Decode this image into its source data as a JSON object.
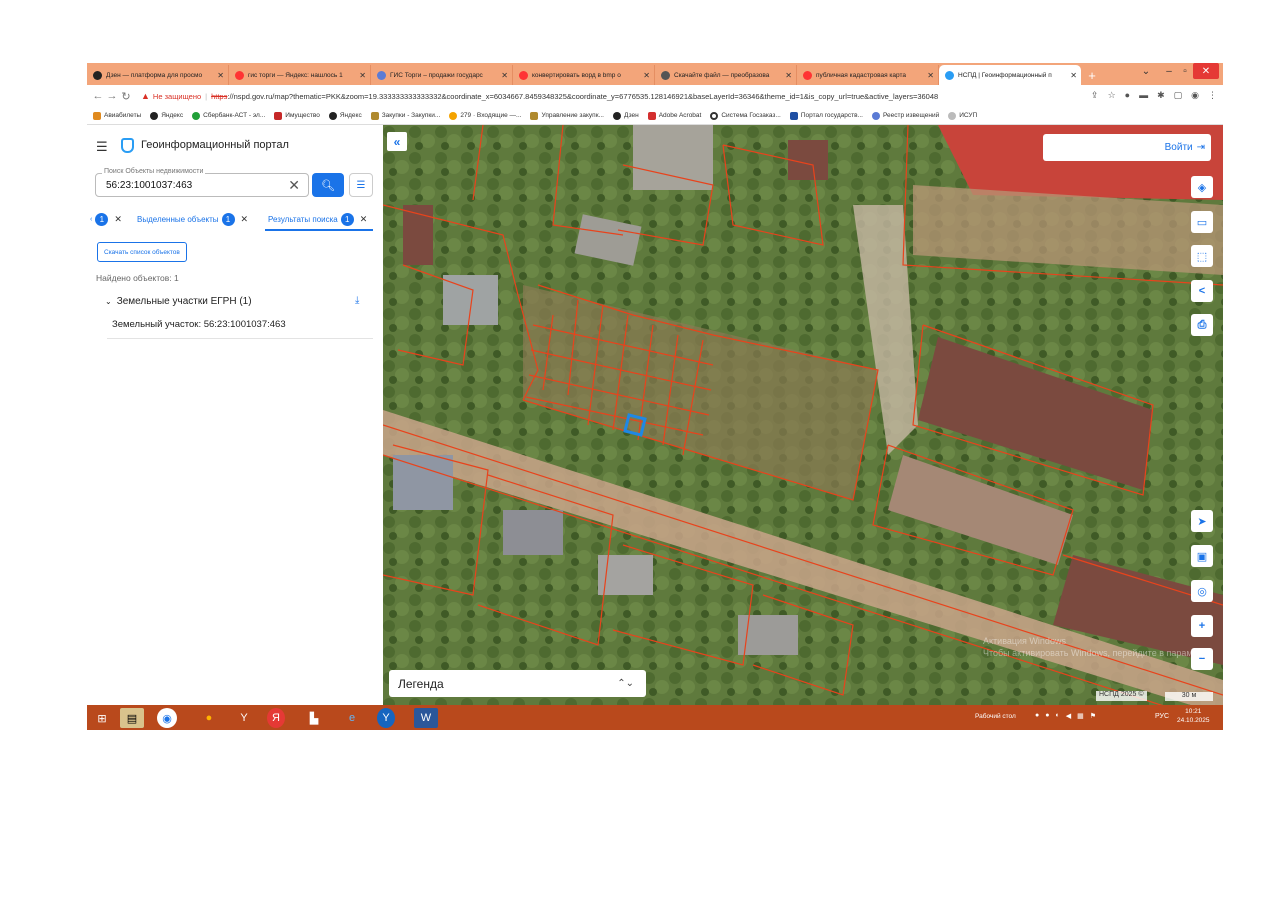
{
  "browser": {
    "tabs": [
      {
        "title": "Дзен — платформа для просмо",
        "icon": "dzen-icon",
        "color": "#222222",
        "active": false
      },
      {
        "title": "гис торги — Яндекс: нашлось 1",
        "icon": "yandex-icon",
        "color": "#f33",
        "active": false
      },
      {
        "title": "ГИС Торги – продажи государс",
        "icon": "gis-torgi-icon",
        "color": "#5b7bd5",
        "active": false
      },
      {
        "title": "конвертировать ворд в bmp о",
        "icon": "yandex-icon",
        "color": "#f33",
        "active": false
      },
      {
        "title": "Скачайте файл — преобразова",
        "icon": "converter-icon",
        "color": "#555555",
        "active": false
      },
      {
        "title": "публичная кадастровая карта",
        "icon": "yandex-icon",
        "color": "#f33",
        "active": false
      },
      {
        "title": "НСПД | Геоинформационный п",
        "icon": "nspd-icon",
        "color": "#2a9df4",
        "active": true
      }
    ],
    "not_secure_label": "Не защищено",
    "url_scheme": "https",
    "url_rest": "://nspd.gov.ru/map?thematic=PKK&zoom=19.333333333333332&coordinate_x=6034667.8459348325&coordinate_y=6776535.128146921&baseLayerId=36346&theme_id=1&is_copy_url=true&active_layers=36048",
    "bookmarks": [
      {
        "label": "Авиабилеты",
        "color": "#e08a1e"
      },
      {
        "label": "Яндекс",
        "color": "#222222"
      },
      {
        "label": "Сбербанк-АСТ - эл...",
        "color": "#21a038"
      },
      {
        "label": "Имущество",
        "color": "#c62828"
      },
      {
        "label": "Яндекс",
        "color": "#222222"
      },
      {
        "label": "Закупки - Закупки...",
        "color": "#b08a2e"
      },
      {
        "label": "279 · Входящие —...",
        "color": "#f4a300"
      },
      {
        "label": "Управление закупк...",
        "color": "#b08a2e"
      },
      {
        "label": "Дзен",
        "color": "#222222"
      },
      {
        "label": "Adobe Acrobat",
        "color": "#d32f2f"
      },
      {
        "label": "Система Госзаказ...",
        "color": "#333333"
      },
      {
        "label": "Портал государств...",
        "color": "#1e4fa3"
      },
      {
        "label": "Реестр извещений",
        "color": "#5b7bd5"
      },
      {
        "label": "ИСУП",
        "color": "#999999"
      }
    ]
  },
  "panel": {
    "title": "Геоинформационный портал",
    "search_legend": "Поиск Объекты недвижимости",
    "search_value": "56:23:1001037:463",
    "tabs": [
      {
        "label": "",
        "count": "1"
      },
      {
        "label": "Выделенные объекты",
        "count": "1"
      },
      {
        "label": "Результаты поиска",
        "count": "1"
      }
    ],
    "download_list_label": "Скачать список объектов",
    "found_label": "Найдено объектов: 1",
    "category_label": "Земельные участки ЕГРН (1)",
    "result_item": "Земельный участок: 56:23:1001037:463"
  },
  "map": {
    "login_label": "Войти",
    "legend_label": "Легенда",
    "watermark_line1": "Активация Windows",
    "watermark_line2": "Чтобы активировать Windows, перейдите в параметры",
    "copyright": "НСПД 2025 ©",
    "scale_label": "30 м",
    "colors": {
      "parcel": "#e8431c",
      "selected": "#1e88e5"
    }
  },
  "taskbar": {
    "desktop_label": "Рабочий стол",
    "lang": "РУС",
    "time": "10:21",
    "date": "24.10.2025"
  }
}
